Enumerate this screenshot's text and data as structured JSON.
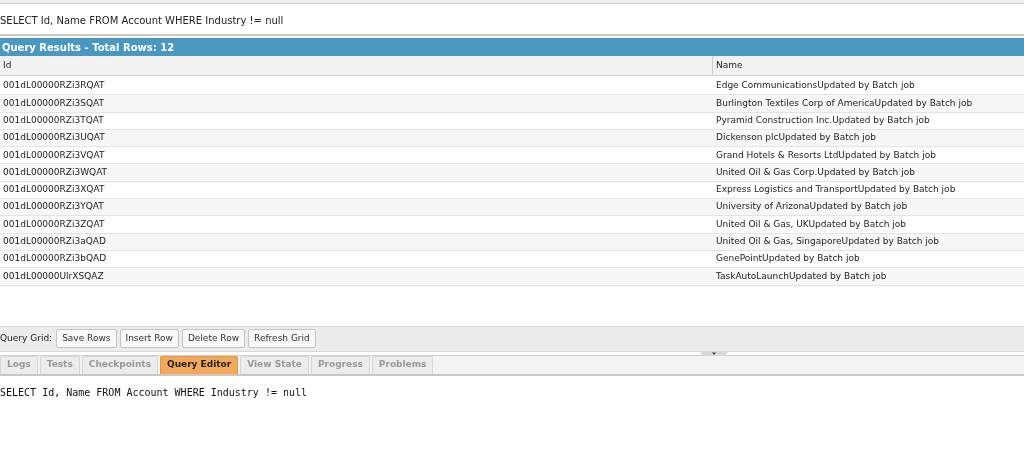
{
  "query_text": "SELECT Id, Name FROM Account WHERE Industry != null",
  "results": {
    "title": "Query Results - Total Rows: 12",
    "columns": [
      "Id",
      "Name"
    ],
    "rows": [
      [
        "001dL00000RZi3RQAT",
        "Edge CommunicationsUpdated by Batch job"
      ],
      [
        "001dL00000RZi3SQAT",
        "Burlington Textiles Corp of AmericaUpdated by Batch job"
      ],
      [
        "001dL00000RZi3TQAT",
        "Pyramid Construction Inc.Updated by Batch job"
      ],
      [
        "001dL00000RZi3UQAT",
        "Dickenson plcUpdated by Batch job"
      ],
      [
        "001dL00000RZi3VQAT",
        "Grand Hotels & Resorts LtdUpdated by Batch job"
      ],
      [
        "001dL00000RZi3WQAT",
        "United Oil & Gas Corp.Updated by Batch job"
      ],
      [
        "001dL00000RZi3XQAT",
        "Express Logistics and TransportUpdated by Batch job"
      ],
      [
        "001dL00000RZi3YQAT",
        "University of ArizonaUpdated by Batch job"
      ],
      [
        "001dL00000RZi3ZQAT",
        "United Oil & Gas, UKUpdated by Batch job"
      ],
      [
        "001dL00000RZi3aQAD",
        "United Oil & Gas, SingaporeUpdated by Batch job"
      ],
      [
        "001dL00000RZi3bQAD",
        "GenePointUpdated by Batch job"
      ],
      [
        "001dL00000UlrXSQAZ",
        "TaskAutoLaunchUpdated by Batch job"
      ]
    ]
  },
  "grid_toolbar": {
    "label": "Query Grid:",
    "buttons": [
      "Save Rows",
      "Insert Row",
      "Delete Row",
      "Refresh Grid"
    ]
  },
  "tabs": [
    {
      "label": "Logs",
      "selected": false
    },
    {
      "label": "Tests",
      "selected": false
    },
    {
      "label": "Checkpoints",
      "selected": false
    },
    {
      "label": "Query Editor",
      "selected": true
    },
    {
      "label": "View State",
      "selected": false
    },
    {
      "label": "Progress",
      "selected": false
    },
    {
      "label": "Problems",
      "selected": false
    }
  ],
  "editor_text": "SELECT Id, Name FROM Account WHERE Industry != null"
}
